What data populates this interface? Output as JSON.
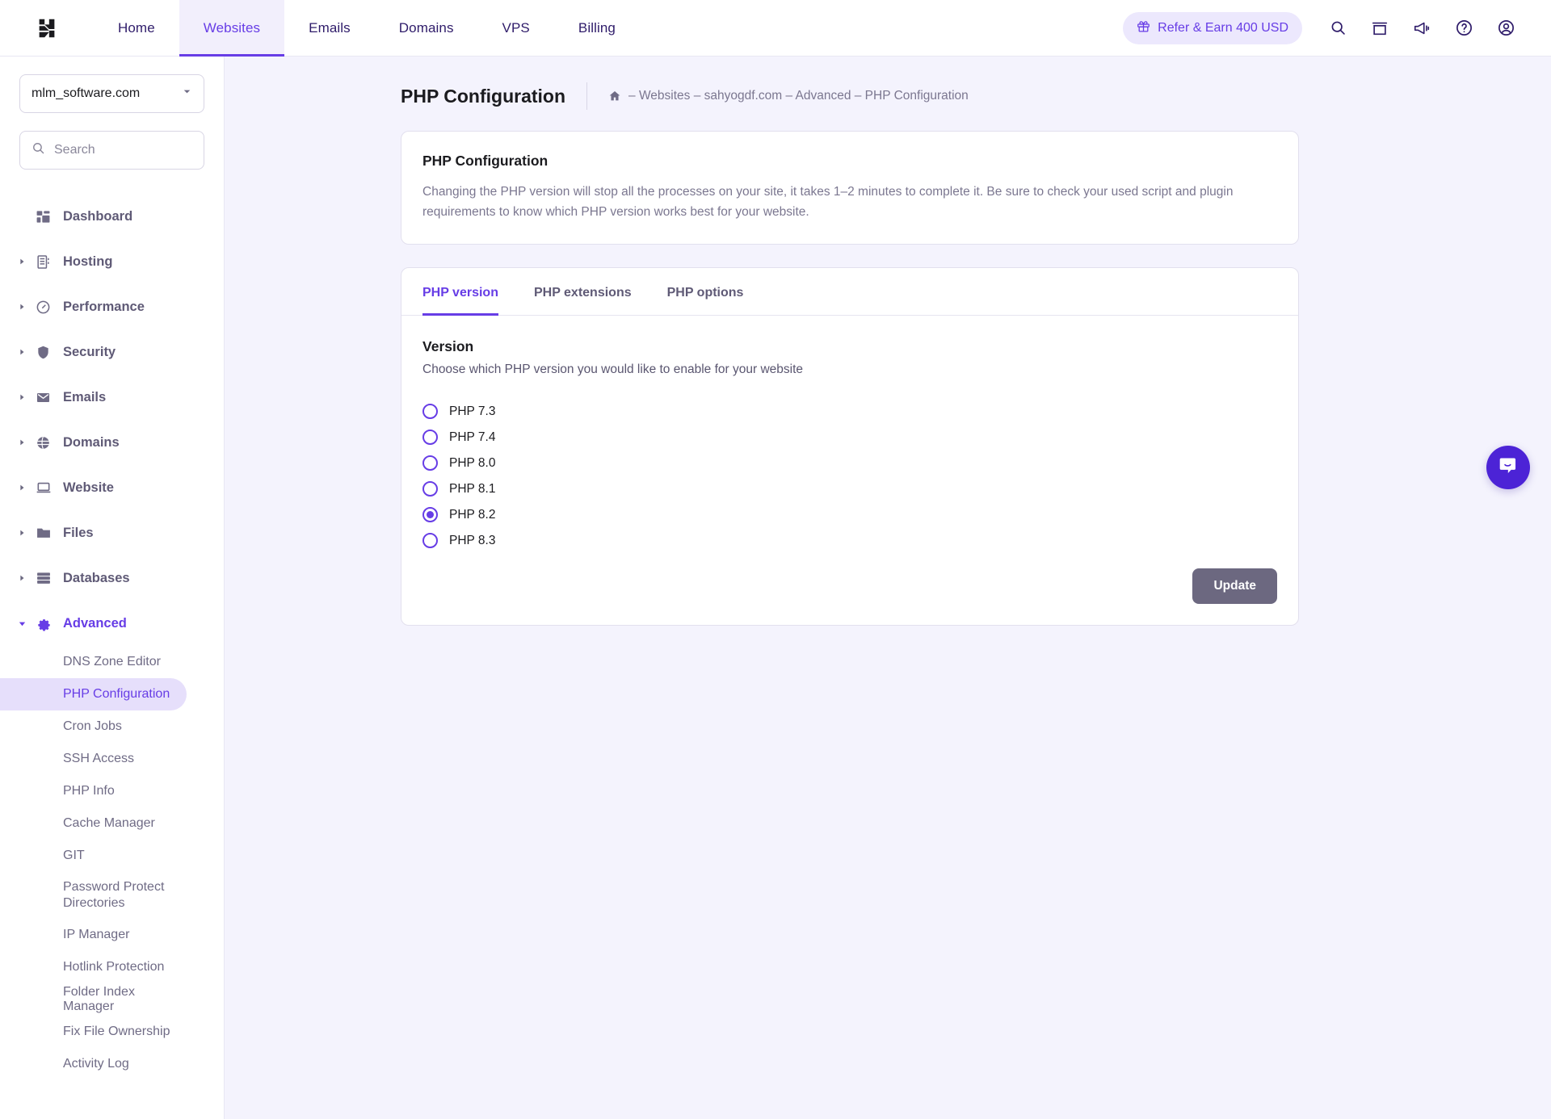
{
  "topbar": {
    "logo_name": "hostinger-logo",
    "nav": [
      {
        "label": "Home",
        "active": false
      },
      {
        "label": "Websites",
        "active": true
      },
      {
        "label": "Emails",
        "active": false
      },
      {
        "label": "Domains",
        "active": false
      },
      {
        "label": "VPS",
        "active": false
      },
      {
        "label": "Billing",
        "active": false
      }
    ],
    "refer_label": "Refer & Earn 400 USD",
    "icons": [
      "search-icon",
      "store-icon",
      "megaphone-icon",
      "help-icon",
      "account-icon"
    ],
    "accent_color": "#673de6",
    "refer_bg": "#ece8fd"
  },
  "sidebar": {
    "domain_selected": "mlm_software.com",
    "search_placeholder": "Search",
    "search_value": "",
    "items": [
      {
        "label": "Dashboard",
        "icon": "dashboard-icon",
        "expandable": false,
        "expanded": false
      },
      {
        "label": "Hosting",
        "icon": "server-icon",
        "expandable": true,
        "expanded": false
      },
      {
        "label": "Performance",
        "icon": "speedometer-icon",
        "expandable": true,
        "expanded": false
      },
      {
        "label": "Security",
        "icon": "shield-icon",
        "expandable": true,
        "expanded": false
      },
      {
        "label": "Emails",
        "icon": "envelope-icon",
        "expandable": true,
        "expanded": false
      },
      {
        "label": "Domains",
        "icon": "globe-icon",
        "expandable": true,
        "expanded": false
      },
      {
        "label": "Website",
        "icon": "laptop-icon",
        "expandable": true,
        "expanded": false
      },
      {
        "label": "Files",
        "icon": "folder-icon",
        "expandable": true,
        "expanded": false
      },
      {
        "label": "Databases",
        "icon": "database-icon",
        "expandable": true,
        "expanded": false
      },
      {
        "label": "Advanced",
        "icon": "gear-icon",
        "expandable": true,
        "expanded": true
      }
    ],
    "advanced_subitems": [
      {
        "label": "DNS Zone Editor",
        "active": false
      },
      {
        "label": "PHP Configuration",
        "active": true
      },
      {
        "label": "Cron Jobs",
        "active": false
      },
      {
        "label": "SSH Access",
        "active": false
      },
      {
        "label": "PHP Info",
        "active": false
      },
      {
        "label": "Cache Manager",
        "active": false
      },
      {
        "label": "GIT",
        "active": false
      },
      {
        "label": "Password Protect Directories",
        "active": false
      },
      {
        "label": "IP Manager",
        "active": false
      },
      {
        "label": "Hotlink Protection",
        "active": false
      },
      {
        "label": "Folder Index Manager",
        "active": false
      },
      {
        "label": "Fix File Ownership",
        "active": false
      },
      {
        "label": "Activity Log",
        "active": false
      }
    ],
    "active_color": "#673de6",
    "active_bg": "#e6dffb"
  },
  "page": {
    "title": "PHP Configuration",
    "breadcrumb": "– Websites – sahyogdf.com – Advanced – PHP Configuration",
    "home_icon": "home-icon"
  },
  "info_card": {
    "title": "PHP Configuration",
    "description": "Changing the PHP version will stop all the processes on your site, it takes 1–2 minutes to complete it. Be sure to check your used script and plugin requirements to know which PHP version works best for your website."
  },
  "tabs": [
    {
      "label": "PHP version",
      "active": true
    },
    {
      "label": "PHP extensions",
      "active": false
    },
    {
      "label": "PHP options",
      "active": false
    }
  ],
  "version_section": {
    "title": "Version",
    "subtitle": "Choose which PHP version you would like to enable for your website",
    "options": [
      {
        "label": "PHP 7.3",
        "selected": false
      },
      {
        "label": "PHP 7.4",
        "selected": false
      },
      {
        "label": "PHP 8.0",
        "selected": false
      },
      {
        "label": "PHP 8.1",
        "selected": false
      },
      {
        "label": "PHP 8.2",
        "selected": true
      },
      {
        "label": "PHP 8.3",
        "selected": false
      }
    ],
    "update_label": "Update"
  },
  "chat": {
    "icon": "chat-bubble-icon",
    "color": "#4c23d6"
  }
}
